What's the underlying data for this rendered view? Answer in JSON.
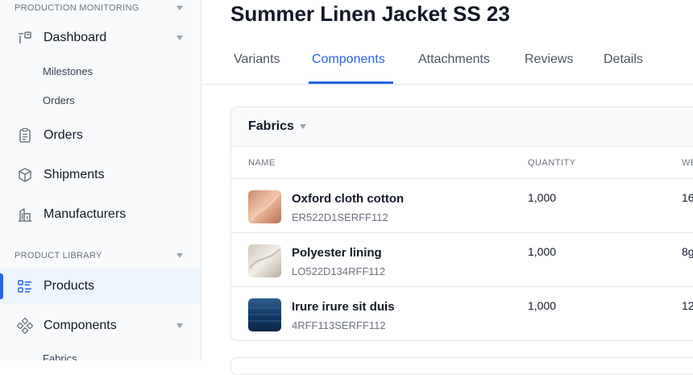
{
  "sidebar": {
    "production_section": "PRODUCTION MONITORING",
    "dashboard": "Dashboard",
    "sub_milestones": "Milestones",
    "sub_orders": "Orders",
    "orders": "Orders",
    "shipments": "Shipments",
    "manufacturers": "Manufacturers",
    "library_section": "PRODUCT LIBRARY",
    "products": "Products",
    "components": "Components",
    "sub_fabrics": "Fabrics"
  },
  "page": {
    "title": "Summer Linen Jacket SS 23"
  },
  "tabs": [
    {
      "label": "Variants"
    },
    {
      "label": "Components",
      "active": true
    },
    {
      "label": "Attachments"
    },
    {
      "label": "Reviews"
    },
    {
      "label": "Details"
    }
  ],
  "card": {
    "title": "Fabrics",
    "columns": {
      "name": "NAME",
      "quantity": "QUANTITY",
      "weight": "WE"
    },
    "rows": [
      {
        "name": "Oxford cloth cotton",
        "code": "ER522D1SERFF112",
        "quantity": "1,000",
        "weight": "16"
      },
      {
        "name": "Polyester lining",
        "code": "LO522D134RFF112",
        "quantity": "1,000",
        "weight": "8g"
      },
      {
        "name": "Irure irure sit duis",
        "code": "4RFF113SERFF112",
        "quantity": "1,000",
        "weight": "12"
      }
    ]
  },
  "colors": {
    "accent": "#2563eb",
    "active_bg": "#eef4fc"
  }
}
